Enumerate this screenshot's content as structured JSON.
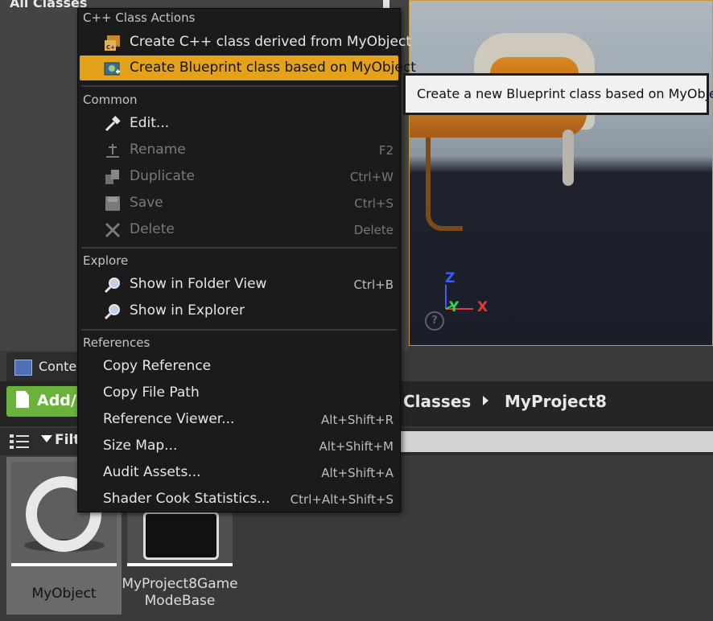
{
  "background": {
    "all_classes_title": "All Classes",
    "content_tab_label": "Conten",
    "add_button_label": "Add/I",
    "breadcrumb": [
      "Classes",
      "MyProject8"
    ],
    "filter_label": "Filt",
    "assets": [
      {
        "name": "MyObject"
      },
      {
        "name_line1": "MyProject8Game",
        "name_line2": "ModeBase"
      }
    ],
    "axes": {
      "z": "Z",
      "y": "Y",
      "x": "X"
    },
    "help_glyph": "?"
  },
  "menu": {
    "sections": {
      "cpp": "C++ Class Actions",
      "common": "Common",
      "explore": "Explore",
      "references": "References"
    },
    "cpp_items": [
      {
        "label": "Create C++ class derived from MyObject",
        "icon": "cpp-class-icon"
      },
      {
        "label": "Create Blueprint class based on MyObject",
        "icon": "blueprint-class-icon"
      }
    ],
    "common_items": [
      {
        "label": "Edit...",
        "shortcut": "",
        "icon": "hammer-icon"
      },
      {
        "label": "Rename",
        "shortcut": "F2",
        "icon": "rename-icon"
      },
      {
        "label": "Duplicate",
        "shortcut": "Ctrl+W",
        "icon": "duplicate-icon"
      },
      {
        "label": "Save",
        "shortcut": "Ctrl+S",
        "icon": "save-icon"
      },
      {
        "label": "Delete",
        "shortcut": "Delete",
        "icon": "delete-icon"
      }
    ],
    "explore_items": [
      {
        "label": "Show in Folder View",
        "shortcut": "Ctrl+B",
        "icon": "magnifier-icon"
      },
      {
        "label": "Show in Explorer",
        "shortcut": "",
        "icon": "magnifier-icon"
      }
    ],
    "reference_items": [
      {
        "label": "Copy Reference",
        "shortcut": ""
      },
      {
        "label": "Copy File Path",
        "shortcut": ""
      },
      {
        "label": "Reference Viewer...",
        "shortcut": "Alt+Shift+R"
      },
      {
        "label": "Size Map...",
        "shortcut": "Alt+Shift+M"
      },
      {
        "label": "Audit Assets...",
        "shortcut": "Alt+Shift+A"
      },
      {
        "label": "Shader Cook Statistics...",
        "shortcut": "Ctrl+Alt+Shift+S"
      }
    ]
  },
  "tooltip": {
    "text": "Create a new Blueprint class based on MyObject."
  },
  "colors": {
    "highlight": "#e4a21b",
    "add_button": "#6ab33b",
    "menu_bg": "#1b1b1b"
  }
}
